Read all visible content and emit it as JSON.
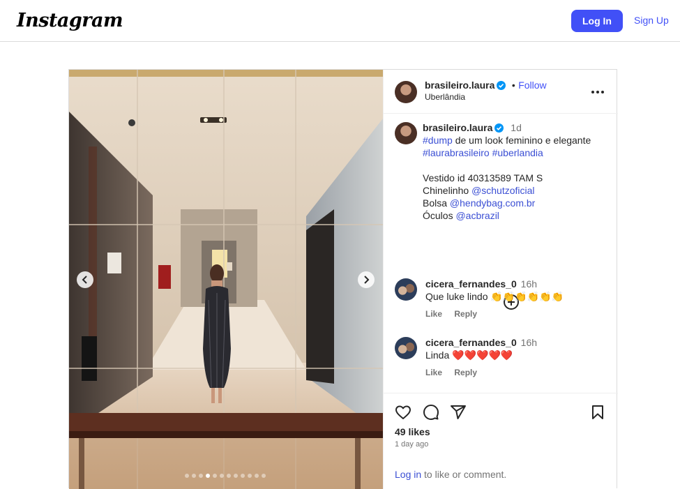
{
  "header": {
    "logo": "Instagram",
    "login_label": "Log In",
    "signup_label": "Sign Up"
  },
  "carousel": {
    "slide_count": 12,
    "active_index": 3
  },
  "post_header": {
    "username": "brasileiro.laura",
    "separator": "•",
    "follow_label": "Follow",
    "location": "Uberlândia"
  },
  "caption": {
    "username": "brasileiro.laura",
    "time": "1d",
    "hashtag_dump": "#dump",
    "line1_rest": " de um look feminino e elegante",
    "hashtag_laura": "#laurabrasileiro",
    "hashtag_uberlandia": "#uberlandia",
    "dress_line": "Vestido id 40313589 TAM S",
    "sandals_label": "Chinelinho ",
    "sandals_handle": "@schutzoficial",
    "bag_label": "Bolsa ",
    "bag_handle": "@hendybag.com.br",
    "glasses_label": "Óculos ",
    "glasses_handle": "@acbrazil"
  },
  "comments": [
    {
      "username": "cicera_fernandes_0",
      "time": "16h",
      "text": "Que luke lindo 👏👏👏👏👏👏",
      "like_label": "Like",
      "reply_label": "Reply"
    },
    {
      "username": "cicera_fernandes_0",
      "time": "16h",
      "text": "Linda ❤️❤️❤️❤️❤️",
      "like_label": "Like",
      "reply_label": "Reply"
    }
  ],
  "stats": {
    "likes": "49 likes",
    "posted": "1 day ago"
  },
  "footer": {
    "login_link": "Log in",
    "login_rest": " to like or comment."
  },
  "colors": {
    "accent": "#4150f7",
    "link": "#3b4fd4",
    "verified": "#0095f6",
    "border": "#dbdbdb"
  }
}
